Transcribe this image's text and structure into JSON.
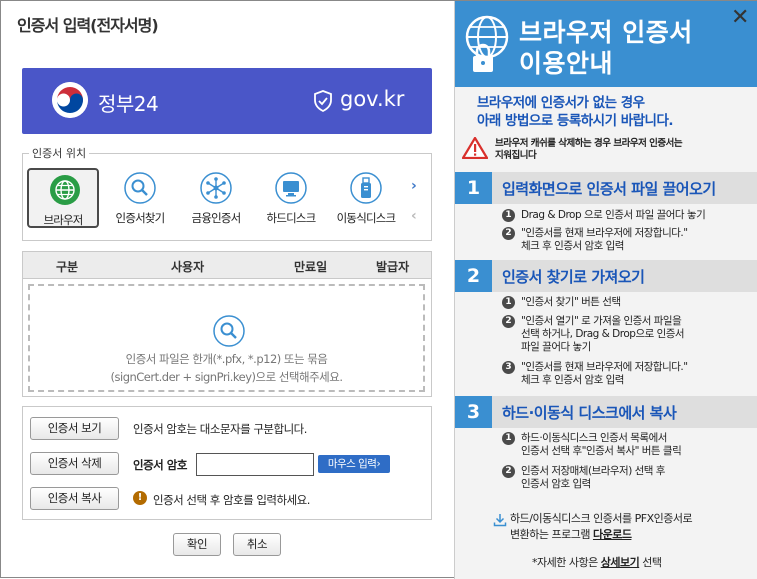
{
  "dialog": {
    "title": "인증서 입력(전자서명)"
  },
  "banner": {
    "gov_name": "정부24",
    "gov_domain": "gov.kr",
    "brand_color": "#4a56c8"
  },
  "location": {
    "legend": "인증서 위치",
    "items": [
      {
        "label": "브라우저",
        "icon": "globe-icon",
        "selected": true
      },
      {
        "label": "인증서찾기",
        "icon": "magnifier-icon",
        "selected": false
      },
      {
        "label": "금융인증서",
        "icon": "network-icon",
        "selected": false
      },
      {
        "label": "하드디스크",
        "icon": "monitor-icon",
        "selected": false
      },
      {
        "label": "이동식디스크",
        "icon": "usb-drive-icon",
        "selected": false
      }
    ],
    "next_arrow": "›",
    "prev_arrow": "‹"
  },
  "table": {
    "columns": [
      "구분",
      "사용자",
      "만료일",
      "발급자"
    ],
    "drop_text_1": "인증서 파일은 한개(*.pfx, *.p12) 또는 묶음",
    "drop_text_2": "(signCert.der + signPri.key)으로 선택해주세요."
  },
  "actions": {
    "view_button": "인증서 보기",
    "delete_button": "인증서 삭제",
    "copy_button": "인증서 복사",
    "case_note": "인증서 암호는 대소문자를 구분합니다.",
    "password_label": "인증서 암호",
    "password_value": "",
    "mouse_input_button": "마우스 입력›",
    "select_note": "인증서 선택 후 암호를 입력하세요."
  },
  "footer": {
    "ok_button": "확인",
    "cancel_button": "취소"
  },
  "guide": {
    "title_line1": "브라우저 인증서",
    "title_line2": "이용안내",
    "close": "✕",
    "intro_line1": "브라우저에 인증서가 없는 경우",
    "intro_line2": "아래 방법으로 등록하시기 바랍니다.",
    "warning_line1": "브라우저 캐쉬를 삭제하는 경우 브라우저 인증서는",
    "warning_line2": "지워집니다",
    "accent_color": "#3a8fd1",
    "sections": [
      {
        "num": "1",
        "title": "입력화면으로 인증서 파일 끌어오기",
        "steps": [
          {
            "num": "1",
            "lines": [
              "Drag & Drop 으로 인증서 파일 끌어다 놓기"
            ]
          },
          {
            "num": "2",
            "lines": [
              "\"인증서를 현재 브라우저에 저장합니다.\"",
              "체크 후 인증서 암호 입력"
            ]
          }
        ]
      },
      {
        "num": "2",
        "title": "인증서 찾기로 가져오기",
        "steps": [
          {
            "num": "1",
            "lines": [
              "\"인증서 찾기\" 버튼 선택"
            ]
          },
          {
            "num": "2",
            "lines": [
              "\"인증서 열기\" 로 가져올 인증서 파일을",
              "선택 하거나, Drag & Drop으로 인증서",
              "파일 끌어다 놓기"
            ]
          },
          {
            "num": "3",
            "lines": [
              "\"인증서를 현재 브라우저에 저장합니다.\"",
              "체크 후 인증서 암호 입력"
            ]
          }
        ]
      },
      {
        "num": "3",
        "title": "하드·이동식 디스크에서 복사",
        "steps": [
          {
            "num": "1",
            "lines": [
              "하드·이동식디스크 인증서 목록에서",
              "인증서 선택 후\"인증서 복사\" 버튼 클릭"
            ]
          },
          {
            "num": "2",
            "lines": [
              "인증서 저장매체(브라우저) 선택 후",
              "인증서 암호 입력"
            ]
          }
        ]
      }
    ],
    "download_line1": "하드/이동식디스크 인증서를 PFX인증서로",
    "download_line2_prefix": "변환하는 프로그램 ",
    "download_link": "다운로드",
    "detail_prefix": "*자세한 사항은 ",
    "detail_link": "상세보기",
    "detail_suffix": " 선택"
  }
}
